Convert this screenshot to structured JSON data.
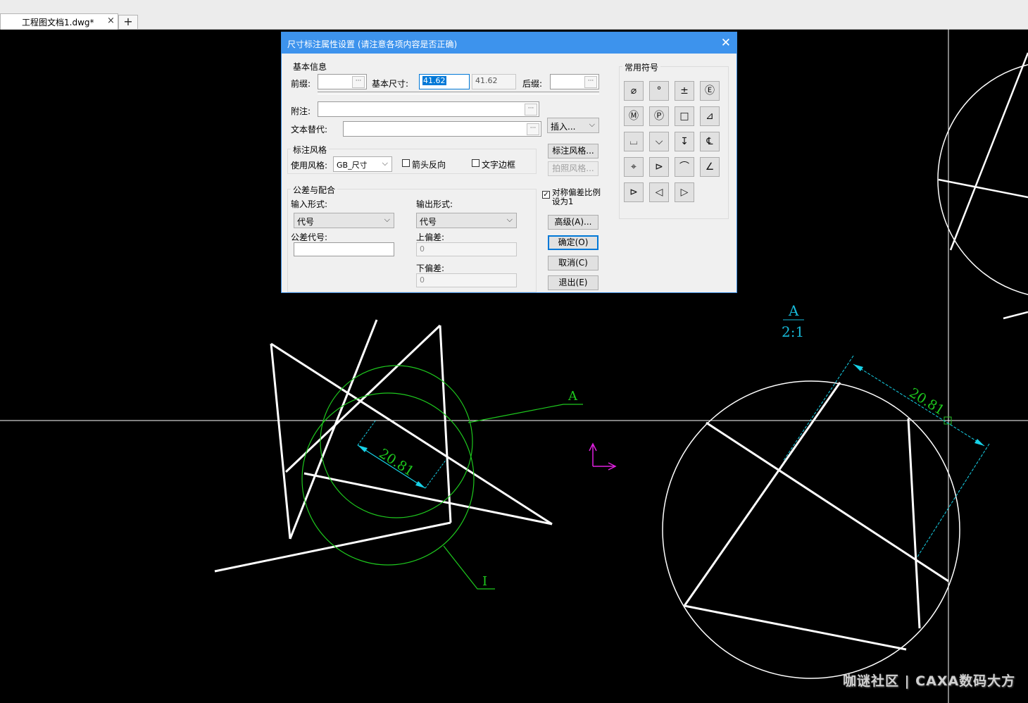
{
  "tab": {
    "title": "工程图文档1.dwg*",
    "close": "×",
    "new": "+"
  },
  "watermark": "咖谜社区 | CAXA数码大方",
  "drawing": {
    "view_label_letter": "A",
    "view_label_scale": "2:1",
    "dim_left": "20.81",
    "dim_right": "20.81",
    "leader_A": "A",
    "leader_I": "I"
  },
  "dialog": {
    "title": "尺寸标注属性设置 (请注意各项内容是否正确)",
    "close": "✕",
    "basic": {
      "group": "基本信息",
      "prefix_label": "前缀:",
      "prefix_value": "",
      "base_label": "基本尺寸:",
      "base_value": "41.62",
      "measured_value": "41.62",
      "suffix_label": "后缀:",
      "suffix_value": "",
      "note_label": "附注:",
      "note_value": "",
      "replace_label": "文本替代:",
      "replace_value": "",
      "insert_label": "插入..."
    },
    "style": {
      "group": "标注风格",
      "use_label": "使用风格:",
      "use_value": "GB_尺寸",
      "arrow_reverse": "箭头反向",
      "text_border": "文字边框",
      "style_btn": "标注风格...",
      "photo_btn": "拍照风格..."
    },
    "tolerance": {
      "group": "公差与配合",
      "input_label": "输入形式:",
      "input_value": "代号",
      "output_label": "输出形式:",
      "output_value": "代号",
      "code_label": "公差代号:",
      "code_value": "",
      "upper_label": "上偏差:",
      "upper_value": "0",
      "lower_label": "下偏差:",
      "lower_value": "0",
      "symmetric_label_1": "对称偏差比例",
      "symmetric_label_2": "设为1",
      "symmetric_checked": true
    },
    "buttons": {
      "advanced": "高级(A)...",
      "ok": "确定(O)",
      "cancel": "取消(C)",
      "exit": "退出(E)"
    },
    "symbols": {
      "group": "常用符号",
      "items": [
        "⌀",
        "°",
        "±",
        "Ⓔ",
        "Ⓜ",
        "Ⓟ",
        "□",
        "⊿",
        "⌴",
        "⌵",
        "↧",
        "℄",
        "⌖",
        "⊳",
        "⌒",
        "∠",
        "⊳",
        "◁",
        "▷"
      ]
    }
  }
}
